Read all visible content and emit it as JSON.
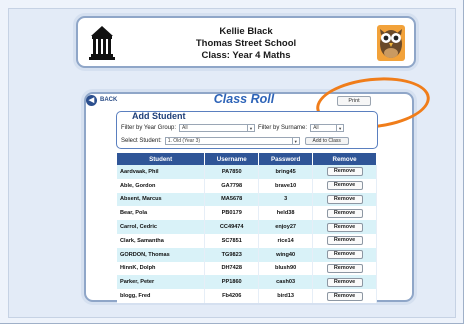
{
  "header": {
    "teacher_name": "Kellie Black",
    "school_name": "Thomas Street School",
    "class_label": "Class: Year 4 Maths",
    "left_logo_icon": "school-building-icon",
    "right_logo_icon": "owl-mascot-icon"
  },
  "nav": {
    "back_label": "BACK",
    "back_icon": "arrow-left-icon"
  },
  "page": {
    "title": "Class Roll",
    "print_label": "Print",
    "highlight_color": "#f07d1a"
  },
  "add_student": {
    "title": "Add Student",
    "year_group_label": "Filter by Year Group:",
    "year_group_value": "All",
    "surname_label": "Filter by Surname:",
    "surname_value": "All",
    "select_label": "Select Student:",
    "select_value": "1. Old (Year 3)",
    "add_button_label": "Add to Class"
  },
  "table": {
    "headers": [
      "Student",
      "Username",
      "Password",
      "Remove"
    ],
    "remove_label": "Remove",
    "rows": [
      {
        "student": "Aardvaak, Phil",
        "username": "PA7850",
        "password": "bring45"
      },
      {
        "student": "Able, Gordon",
        "username": "GA7798",
        "password": "brave10"
      },
      {
        "student": "Absent, Marcus",
        "username": "MA5678",
        "password": "3"
      },
      {
        "student": "Bear, Pola",
        "username": "PB0179",
        "password": "held38"
      },
      {
        "student": "Carrol, Cedric",
        "username": "CC49474",
        "password": "enjoy27"
      },
      {
        "student": "Clark, Samantha",
        "username": "SC7851",
        "password": "rice14"
      },
      {
        "student": "GORDON, Thomas",
        "username": "TG9823",
        "password": "wing40"
      },
      {
        "student": "HinnK, Dolph",
        "username": "DH7428",
        "password": "blush90"
      },
      {
        "student": "Parker, Peter",
        "username": "PP1860",
        "password": "cash03"
      },
      {
        "student": "blogg, Fred",
        "username": "Fb4206",
        "password": "bird13"
      }
    ]
  },
  "colors": {
    "accent": "#2e64b8",
    "table_header": "#2f5597",
    "row_alt": "#d9f2f8"
  }
}
